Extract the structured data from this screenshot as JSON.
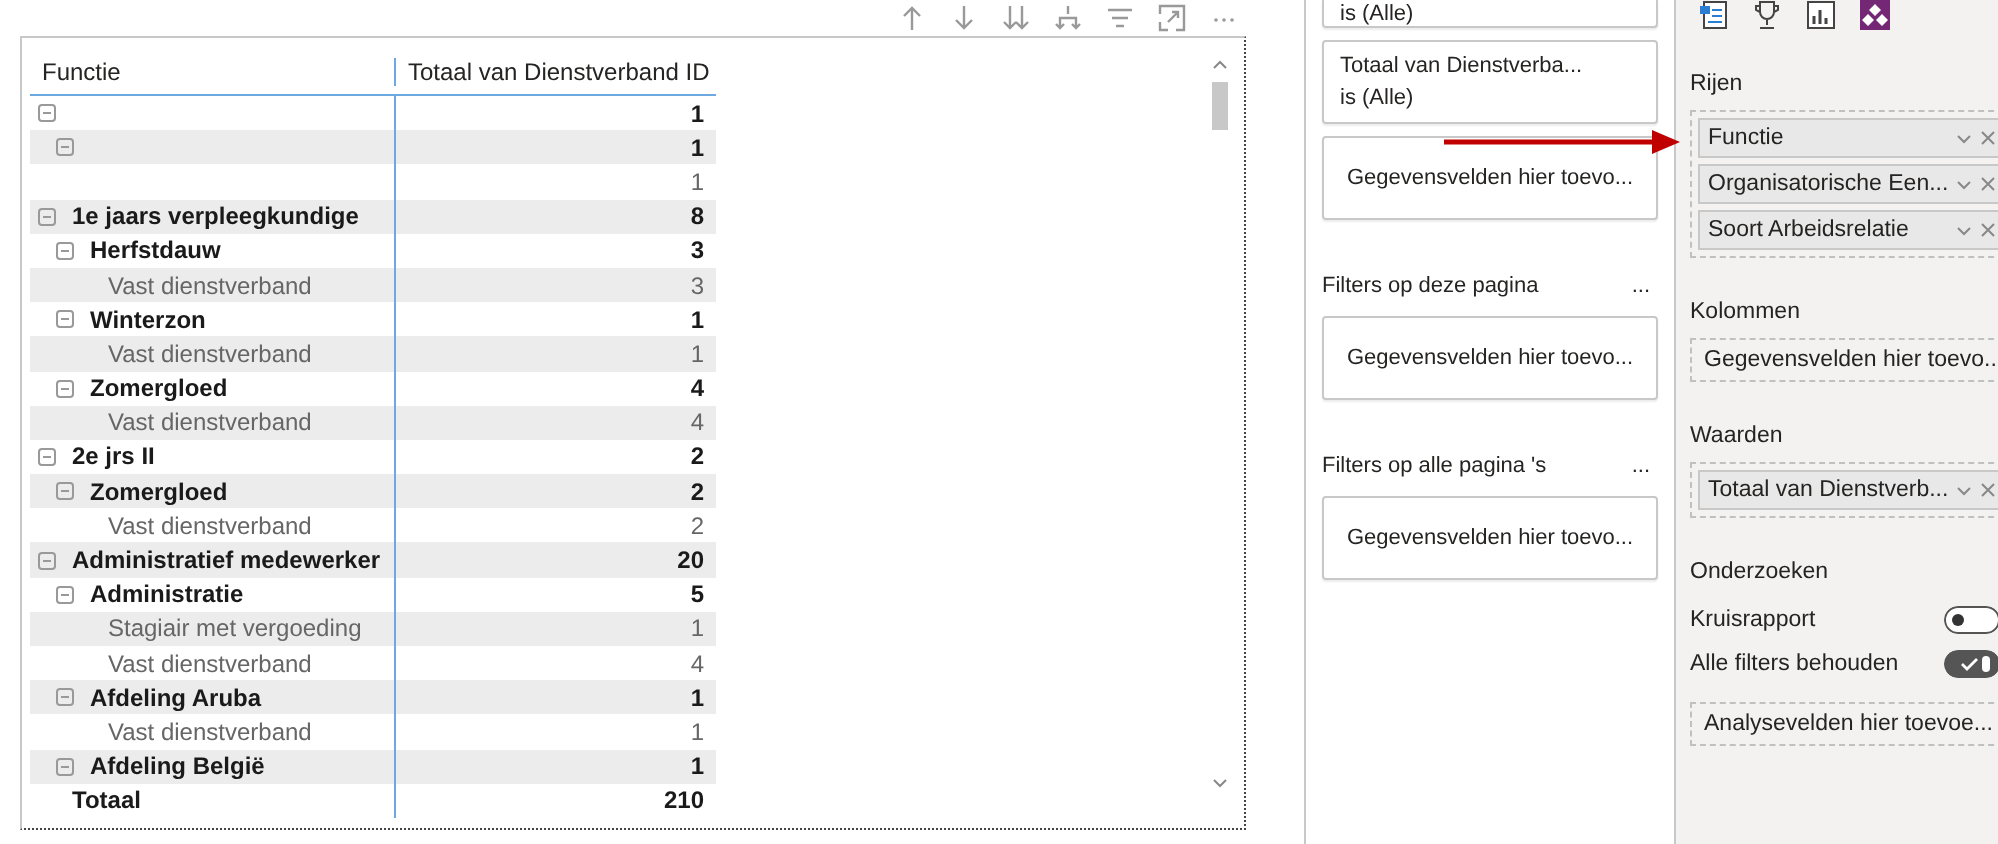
{
  "table": {
    "columns": [
      "Functie",
      "Totaal van Dienstverband ID"
    ],
    "rows": [
      {
        "value": "1",
        "expanded": true,
        "children": [
          {
            "value": "1",
            "expanded": true,
            "children": [
              {
                "value": "1"
              }
            ]
          }
        ]
      },
      {
        "label": "1e jaars verpleegkundige",
        "value": "8",
        "expanded": true,
        "children": [
          {
            "label": "Herfstdauw",
            "value": "3",
            "expanded": true,
            "children": [
              {
                "label": "Vast dienstverband",
                "value": "3"
              }
            ]
          },
          {
            "label": "Winterzon",
            "value": "1",
            "expanded": true,
            "children": [
              {
                "label": "Vast dienstverband",
                "value": "1"
              }
            ]
          },
          {
            "label": "Zomergloed",
            "value": "4",
            "expanded": true,
            "children": [
              {
                "label": "Vast dienstverband",
                "value": "4"
              }
            ]
          }
        ]
      },
      {
        "label": "2e jrs II",
        "value": "2",
        "expanded": true,
        "children": [
          {
            "label": "Zomergloed",
            "value": "2",
            "expanded": true,
            "children": [
              {
                "label": "Vast dienstverband",
                "value": "2"
              }
            ]
          }
        ]
      },
      {
        "label": "Administratief medewerker",
        "value": "20",
        "expanded": true,
        "children": [
          {
            "label": "Administratie",
            "value": "5",
            "expanded": true,
            "children": [
              {
                "label": "Stagiair met vergoeding",
                "value": "1"
              },
              {
                "label": "Vast dienstverband",
                "value": "4"
              }
            ]
          },
          {
            "label": "Afdeling Aruba",
            "value": "1",
            "expanded": true,
            "children": [
              {
                "label": "Vast dienstverband",
                "value": "1"
              }
            ]
          },
          {
            "label": "Afdeling België",
            "value": "1",
            "expanded": true
          }
        ]
      }
    ],
    "total": {
      "label": "Totaal",
      "value": "210"
    }
  },
  "filters_pane": {
    "visual_filters": [
      {
        "condition": "is (Alle)"
      },
      {
        "field": "Totaal van Dienstverba...",
        "condition": "is (Alle)"
      }
    ],
    "visual_placeholder": "Gegevensvelden hier toevo...",
    "sections": [
      {
        "title": "Filters op deze pagina",
        "more": "...",
        "placeholder": "Gegevensvelden hier toevo..."
      },
      {
        "title": "Filters op alle pagina 's",
        "more": "...",
        "placeholder": "Gegevensvelden hier toevo..."
      }
    ]
  },
  "visualizations_pane": {
    "wells": [
      {
        "title": "Rijen",
        "fields": [
          {
            "name": "Functie"
          },
          {
            "name": "Organisatorische Een..."
          },
          {
            "name": "Soort Arbeidsrelatie"
          }
        ]
      },
      {
        "title": "Kolommen",
        "placeholder": "Gegevensvelden hier toevo..."
      },
      {
        "title": "Waarden",
        "fields": [
          {
            "name": "Totaal van Dienstverb..."
          }
        ]
      }
    ],
    "drill": {
      "title": "Onderzoeken",
      "toggles": [
        {
          "label": "Kruisrapport",
          "on": false
        },
        {
          "label": "Alle filters behouden",
          "on": true
        }
      ],
      "placeholder": "Analysevelden hier toevoe..."
    }
  }
}
